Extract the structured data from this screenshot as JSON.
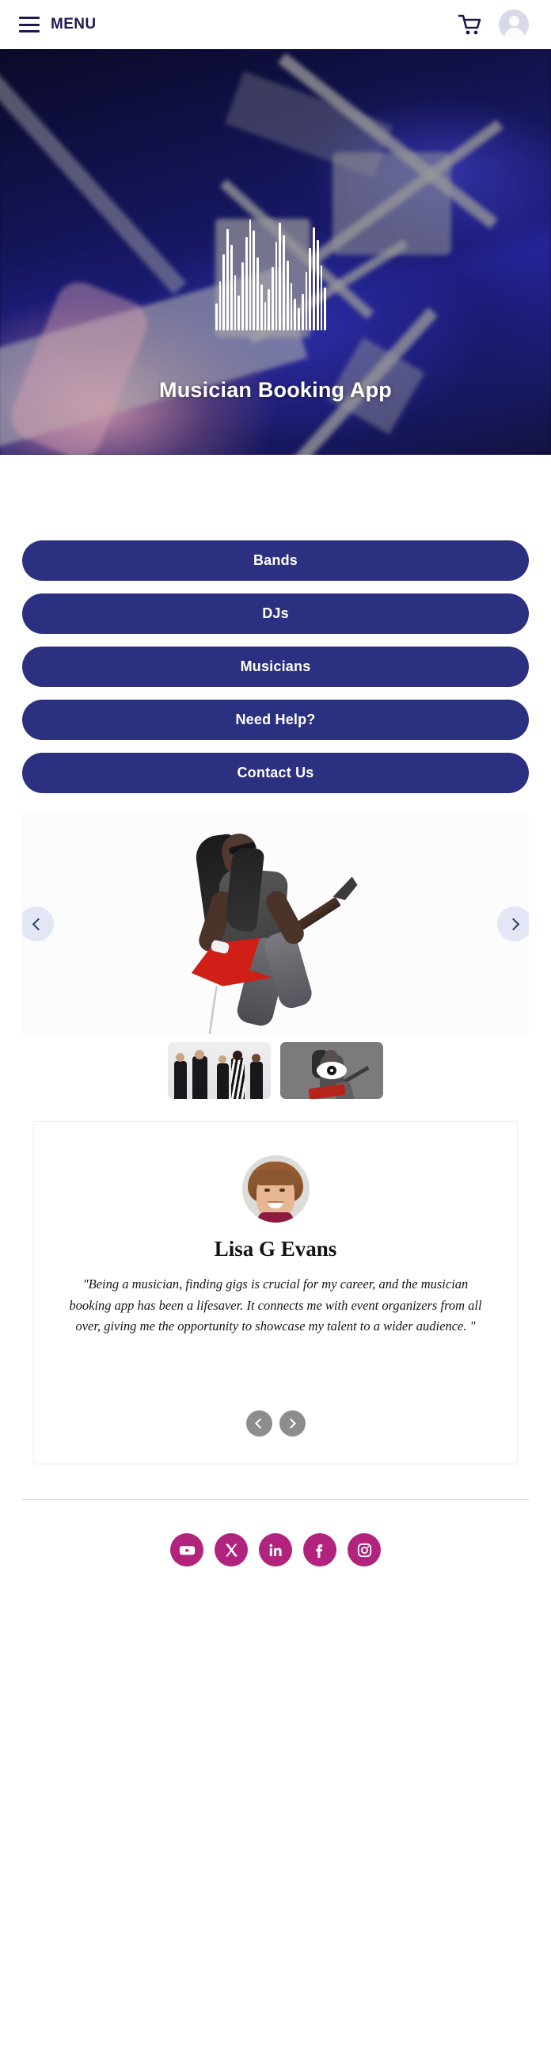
{
  "header": {
    "menu_label": "MENU",
    "menu_icon": "hamburger-icon",
    "cart_icon": "shopping-cart-icon",
    "avatar_icon": "user-avatar-icon"
  },
  "hero": {
    "title": "Musician Booking App",
    "background_description": "blurred dark-blue stage photo with instruments",
    "waveform_icon": "audio-waveform-icon",
    "colors": {
      "deep_navy": "#0d0e33",
      "blue": "#242499"
    }
  },
  "nav_buttons": [
    {
      "label": "Bands"
    },
    {
      "label": "DJs"
    },
    {
      "label": "Musicians"
    },
    {
      "label": "Need Help?"
    },
    {
      "label": "Contact Us"
    }
  ],
  "gallery": {
    "prev_icon": "chevron-left-icon",
    "next_icon": "chevron-right-icon",
    "main_image_alt": "Guitarist playing a red flying-V electric guitar",
    "thumbnails": [
      {
        "alt": "Band in formal black attire performing",
        "selected": false
      },
      {
        "alt": "Guitarist with red guitar",
        "selected": true,
        "overlay_icon": "eye-icon"
      }
    ]
  },
  "testimonial": {
    "avatar_alt": "Portrait of Lisa G Evans",
    "name": "Lisa G Evans",
    "quote": "\"Being a musician, finding gigs is crucial for my career, and the musician booking app has been a lifesaver. It connects me with event organizers from all over, giving me the opportunity to showcase my talent to a wider audience. \"",
    "prev_icon": "chevron-left-icon",
    "next_icon": "chevron-right-icon"
  },
  "footer": {
    "socials": [
      {
        "name": "youtube",
        "icon": "youtube-icon"
      },
      {
        "name": "x-twitter",
        "icon": "x-twitter-icon"
      },
      {
        "name": "linkedin",
        "icon": "linkedin-icon"
      },
      {
        "name": "facebook",
        "icon": "facebook-icon"
      },
      {
        "name": "instagram",
        "icon": "instagram-icon"
      }
    ],
    "accent_color": "#b1237d"
  }
}
